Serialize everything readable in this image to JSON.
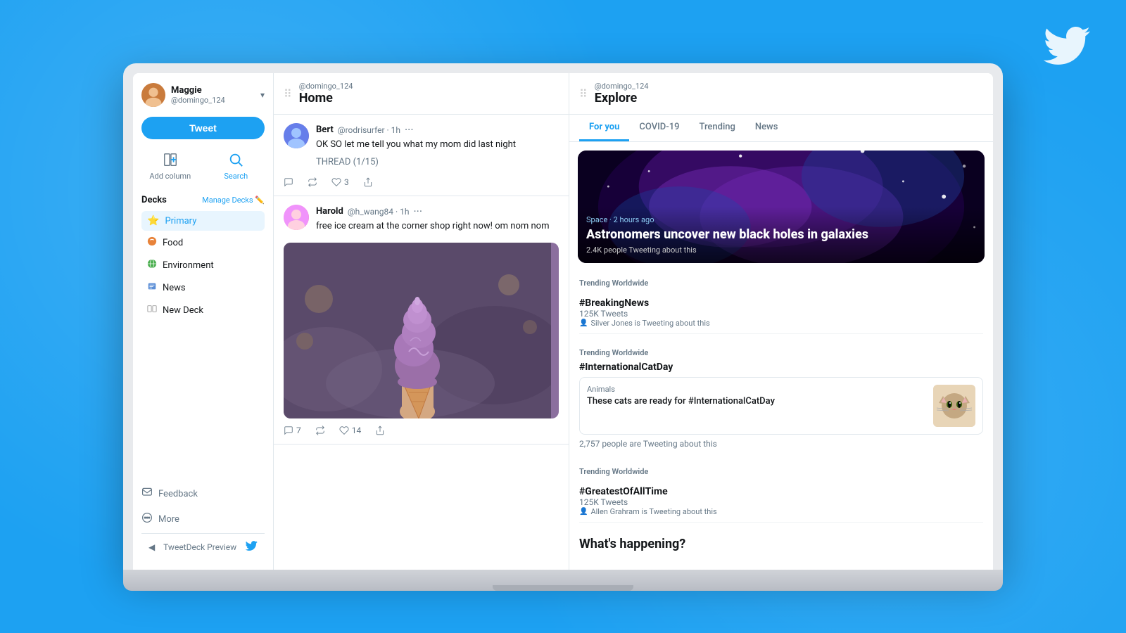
{
  "background": {
    "color": "#1da1f2"
  },
  "twitter_bird": "🐦",
  "sidebar": {
    "user": {
      "display_name": "Maggie",
      "handle": "@domingo_124",
      "avatar_emoji": "👩"
    },
    "tweet_button": "Tweet",
    "actions": [
      {
        "label": "Add column",
        "icon": "➕",
        "name": "add-column"
      },
      {
        "label": "Search",
        "icon": "🔍",
        "name": "search"
      }
    ],
    "decks_title": "Decks",
    "manage_decks_label": "Manage Decks",
    "deck_items": [
      {
        "label": "Primary",
        "icon": "⭐",
        "type": "star",
        "active": true
      },
      {
        "label": "Food",
        "icon": "🍊",
        "type": "food"
      },
      {
        "label": "Environment",
        "icon": "🌍",
        "type": "env"
      },
      {
        "label": "News",
        "icon": "📰",
        "type": "news"
      },
      {
        "label": "New Deck",
        "icon": "➕",
        "type": "new"
      }
    ],
    "footer_items": [
      {
        "label": "Feedback",
        "icon": "💬"
      },
      {
        "label": "More",
        "icon": "⊕"
      }
    ],
    "preview_label": "TweetDeck Preview"
  },
  "home_column": {
    "account": "@domingo_124",
    "title": "Home",
    "tweets": [
      {
        "id": 1,
        "user_name": "Bert",
        "handle": "@rodrisurfer",
        "time": "1h",
        "text": "OK SO let me tell you what my mom did last night",
        "thread": "THREAD (1/15)",
        "reply_count": null,
        "retweet_count": null,
        "like_count": "3",
        "has_image": false
      },
      {
        "id": 2,
        "user_name": "Harold",
        "handle": "@h_wang84",
        "time": "1h",
        "text": "free ice cream at the corner shop right now! om nom nom",
        "thread": null,
        "reply_count": "7",
        "retweet_count": null,
        "like_count": "14",
        "has_image": true
      }
    ]
  },
  "explore_column": {
    "account": "@domingo_124",
    "title": "Explore",
    "tabs": [
      {
        "label": "For you",
        "active": true
      },
      {
        "label": "COVID-19",
        "active": false
      },
      {
        "label": "Trending",
        "active": false
      },
      {
        "label": "News",
        "active": false
      }
    ],
    "space_card": {
      "badge": "Space · 2 hours ago",
      "title": "Astronomers uncover new black holes in galaxies",
      "subtitle": "2.4K people Tweeting about this"
    },
    "trending_items": [
      {
        "label": "Trending Worldwide",
        "hashtag": "#BreakingNews",
        "count": "125K Tweets",
        "meta": "Silver Jones is Tweeting about this"
      },
      {
        "label": "Trending Worldwide",
        "hashtag": "#InternationalCatDay",
        "count": null,
        "meta": null,
        "has_card": true,
        "card": {
          "category": "Animals",
          "title": "These cats are ready for #InternationalCatDay"
        },
        "people": "2,757 people are Tweeting about this"
      },
      {
        "label": "Trending Worldwide",
        "hashtag": "#GreatestOfAllTime",
        "count": "125K Tweets",
        "meta": "Allen Grahram is Tweeting about this"
      }
    ],
    "whats_happening": "What's happening?"
  }
}
